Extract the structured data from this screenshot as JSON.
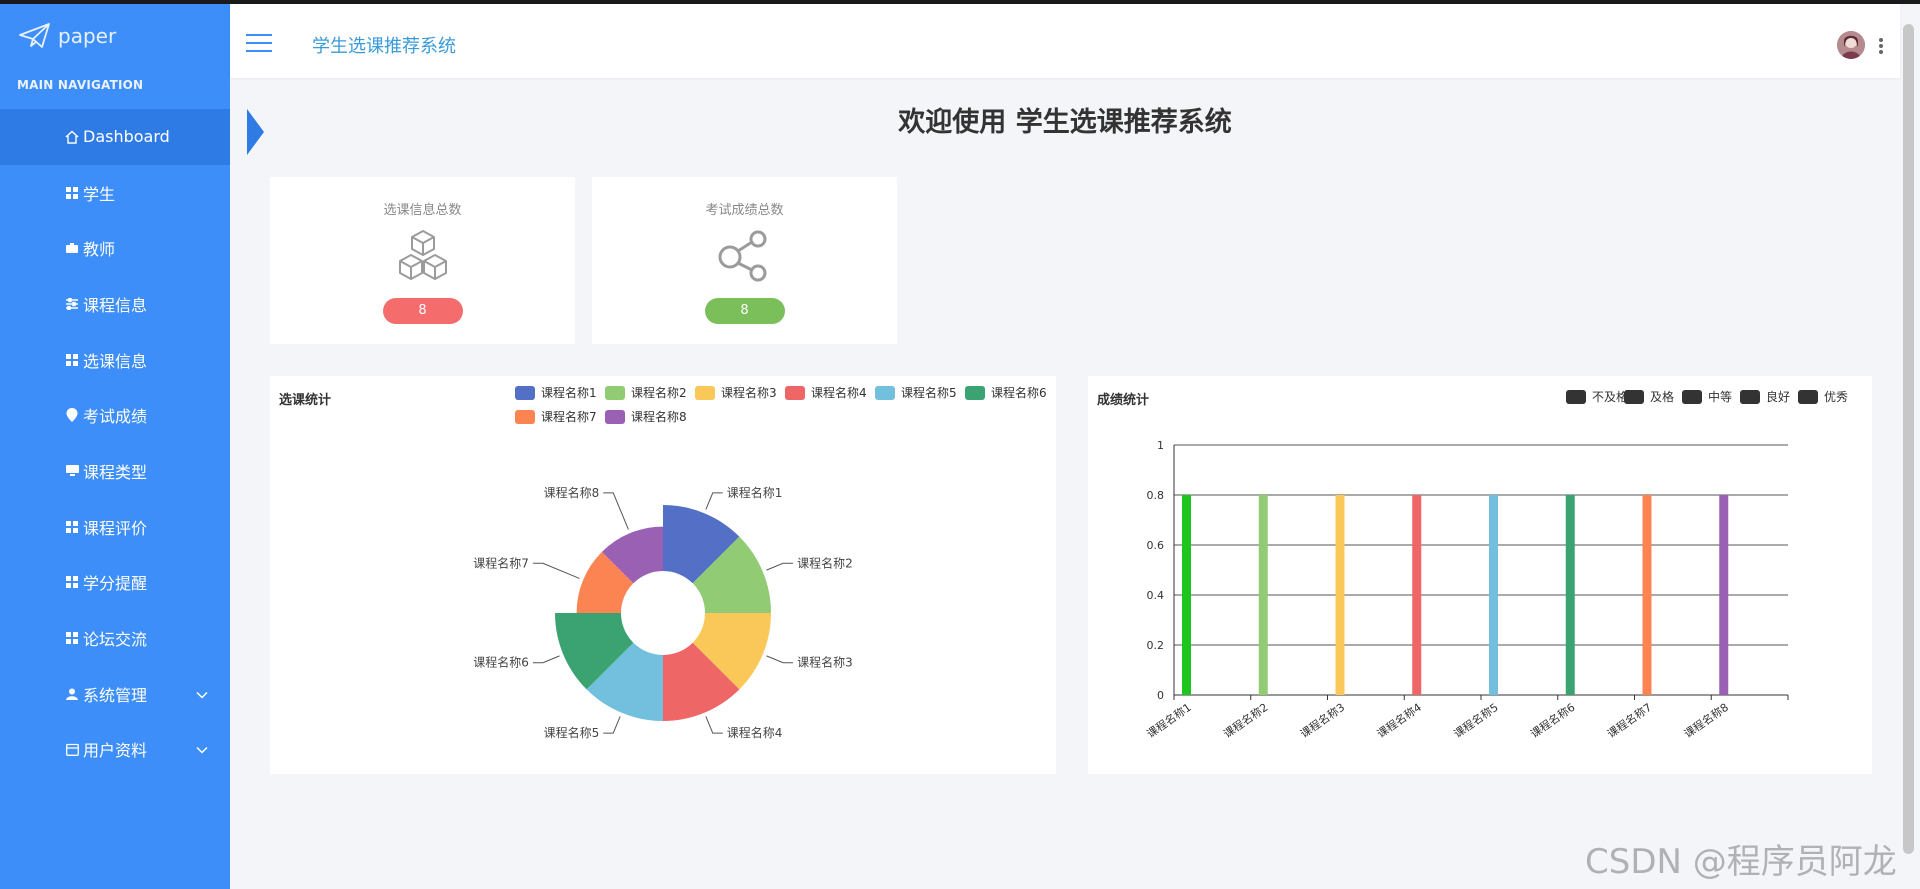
{
  "brand": {
    "name": "paper"
  },
  "sidebar": {
    "heading": "MAIN NAVIGATION",
    "items": [
      {
        "label": "Dashboard",
        "icon": "home-icon",
        "active": true
      },
      {
        "label": "学生",
        "icon": "grid-icon"
      },
      {
        "label": "教师",
        "icon": "briefcase-icon"
      },
      {
        "label": "课程信息",
        "icon": "sliders-icon"
      },
      {
        "label": "选课信息",
        "icon": "grid-icon"
      },
      {
        "label": "考试成绩",
        "icon": "map-pin-icon"
      },
      {
        "label": "课程类型",
        "icon": "monitor-icon"
      },
      {
        "label": "课程评价",
        "icon": "grid-icon"
      },
      {
        "label": "学分提醒",
        "icon": "grid-icon"
      },
      {
        "label": "论坛交流",
        "icon": "grid-icon"
      },
      {
        "label": "系统管理",
        "icon": "user-icon",
        "expandable": true
      },
      {
        "label": "用户资料",
        "icon": "calendar-icon",
        "expandable": true
      }
    ]
  },
  "header": {
    "title": "学生选课推荐系统"
  },
  "main": {
    "welcome": "欢迎使用 学生选课推荐系统"
  },
  "stats": [
    {
      "label": "选课信息总数",
      "value": "8",
      "color": "#f56c6c",
      "icon": "cubes-icon"
    },
    {
      "label": "考试成绩总数",
      "value": "8",
      "color": "#7bbf5b",
      "icon": "share-icon"
    }
  ],
  "chart_data": [
    {
      "type": "pie",
      "title": "选课统计",
      "categories": [
        "课程名称1",
        "课程名称2",
        "课程名称3",
        "课程名称4",
        "课程名称5",
        "课程名称6",
        "课程名称7",
        "课程名称8"
      ],
      "values": [
        1,
        1,
        1,
        1,
        1,
        1,
        1,
        1
      ],
      "colors": [
        "#5470c6",
        "#91cc75",
        "#fac858",
        "#ee6666",
        "#73c0de",
        "#3ba272",
        "#fc8452",
        "#9a60b4"
      ],
      "legend_position": "top-right"
    },
    {
      "type": "bar",
      "title": "成绩统计",
      "categories": [
        "课程名称1",
        "课程名称2",
        "课程名称3",
        "课程名称4",
        "课程名称5",
        "课程名称6",
        "课程名称7",
        "课程名称8"
      ],
      "values": [
        0.8,
        0.8,
        0.8,
        0.8,
        0.8,
        0.8,
        0.8,
        0.8
      ],
      "colors": [
        "#1ec51e",
        "#91cc75",
        "#fac858",
        "#ee6666",
        "#73c0de",
        "#3ba272",
        "#fc8452",
        "#9a60b4"
      ],
      "legend": [
        "不及格",
        "及格",
        "中等",
        "良好",
        "优秀"
      ],
      "legend_color": "#333333",
      "ylim": [
        0,
        1
      ],
      "yticks": [
        "0",
        "0.2",
        "0.4",
        "0.6",
        "0.8",
        "1"
      ],
      "grid": true,
      "legend_position": "top-right"
    }
  ],
  "watermark": "CSDN @程序员阿龙"
}
